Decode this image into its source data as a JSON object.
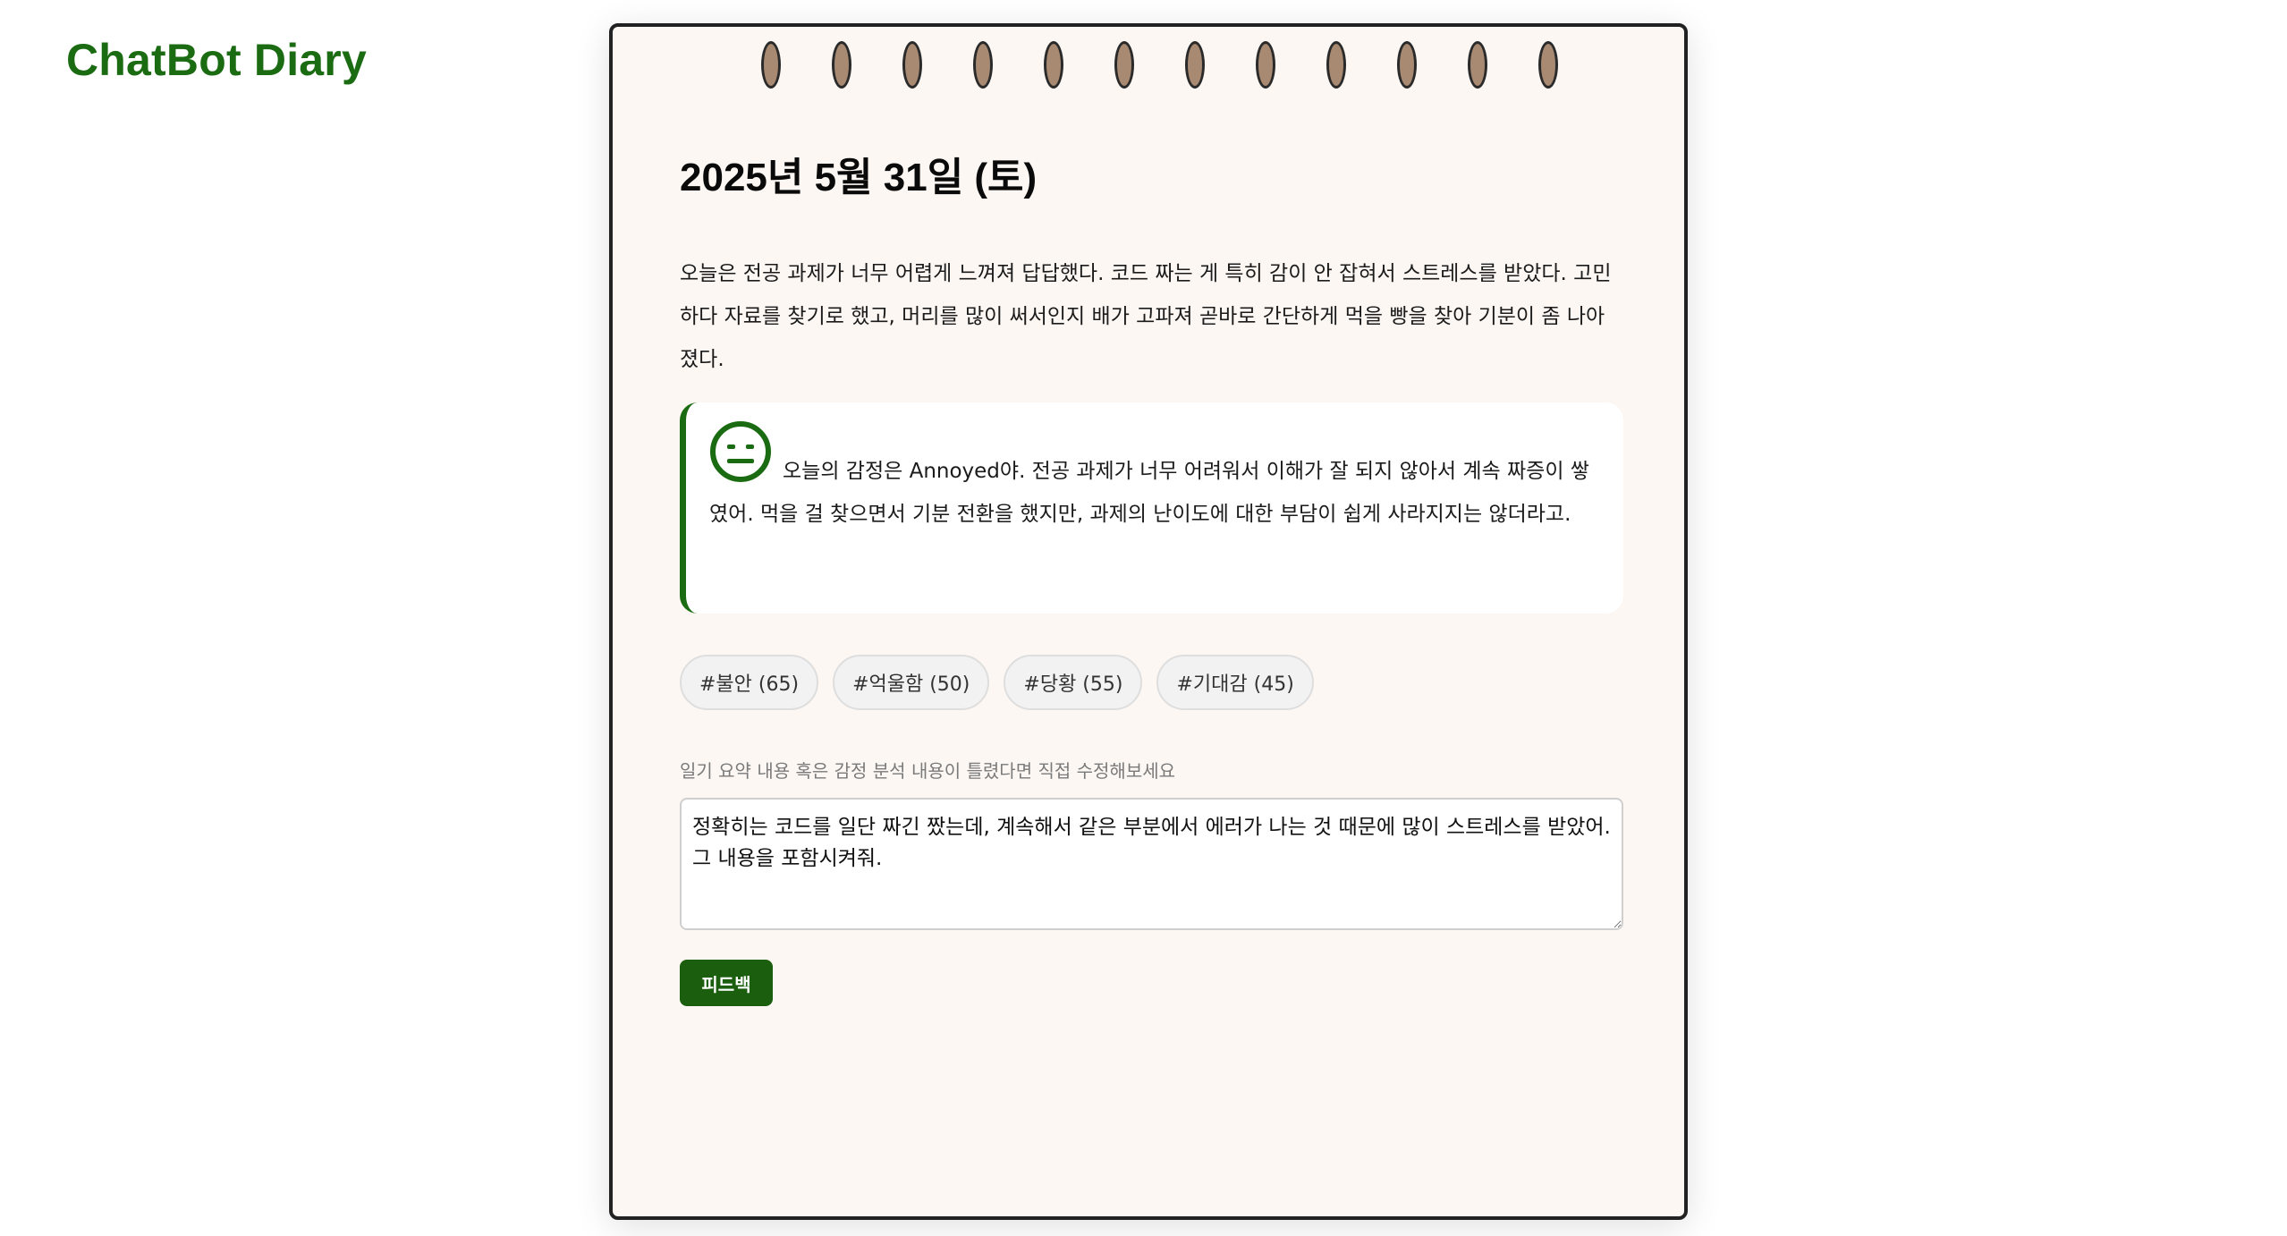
{
  "app": {
    "title": "ChatBot Diary"
  },
  "diary": {
    "date": "2025년 5월 31일 (토)",
    "entry": "오늘은 전공 과제가 너무 어렵게 느껴져 답답했다. 코드 짜는 게 특히 감이 안 잡혀서 스트레스를 받았다. 고민하다 자료를 찾기로 했고, 머리를 많이 써서인지 배가 고파져 곧바로 간단하게 먹을 빵을 찾아 기분이 좀 나아졌다."
  },
  "feedback": {
    "emotion_icon": "neutral-face-icon",
    "text": "오늘의 감정은 Annoyed야. 전공 과제가 너무 어려워서 이해가 잘 되지 않아서 계속 짜증이 쌓였어. 먹을 걸 찾으면서 기분 전환을 했지만, 과제의 난이도에 대한 부담이 쉽게 사라지지는 않더라고."
  },
  "tags": [
    {
      "label": "#불안 (65)"
    },
    {
      "label": "#억울함 (50)"
    },
    {
      "label": "#당황 (55)"
    },
    {
      "label": "#기대감 (45)"
    }
  ],
  "edit": {
    "label": "일기 요약 내용 혹은 감정 분석 내용이 틀렸다면 직접 수정해보세요",
    "value": "정확히는 코드를 일단 짜긴 짰는데, 계속해서 같은 부분에서 에러가 나는 것 때문에 많이 스트레스를 받았어. 그 내용을 포함시켜줘.",
    "submit_label": "피드백"
  },
  "colors": {
    "brand": "#1a6b12",
    "paper": "#fcf7f3",
    "ring": "#a88a72",
    "button": "#1a5e0e"
  }
}
